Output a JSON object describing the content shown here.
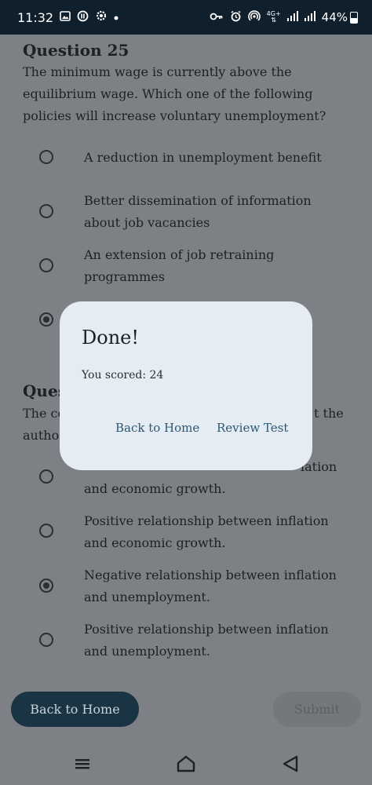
{
  "status_bar": {
    "time": "11:32",
    "left_icons": [
      "image-icon",
      "circle-pause-icon",
      "gear-icon",
      "dot-icon"
    ],
    "right_icons": [
      "key-icon",
      "alarm-icon",
      "hotspot-icon",
      "4g-icon",
      "signal-icon",
      "signal-icon"
    ],
    "network_label": "4G+",
    "battery": "44%"
  },
  "questions": [
    {
      "title": "Question 25",
      "text": "The minimum wage is currently above the equilibrium wage. Which one of the following policies will increase voluntary unemployment?",
      "options": [
        {
          "label": "A reduction in unemployment benefit",
          "selected": false
        },
        {
          "label": "Better dissemination of information about job vacancies",
          "selected": false
        },
        {
          "label": "An extension of job retraining programmes",
          "selected": false
        },
        {
          "label": "",
          "selected": true
        }
      ]
    },
    {
      "title": "Ques",
      "text_lines": [
        "The co",
        "autho"
      ],
      "text_tail": "t the",
      "options": [
        {
          "label": "and economic growth.",
          "selected": false,
          "partial_top": "lation"
        },
        {
          "label": "Positive relationship between inflation and economic growth.",
          "selected": false
        },
        {
          "label": "Negative relationship between inflation and unemployment.",
          "selected": true
        },
        {
          "label": "Positive relationship between inflation and unemployment.",
          "selected": false
        }
      ]
    }
  ],
  "buttons": {
    "back_home": "Back to Home",
    "submit": "Submit"
  },
  "dialog": {
    "title": "Done!",
    "score_text": "You scored: 24",
    "back_home": "Back to Home",
    "review": "Review Test"
  },
  "nav": [
    "menu-icon",
    "home-icon",
    "back-icon"
  ]
}
